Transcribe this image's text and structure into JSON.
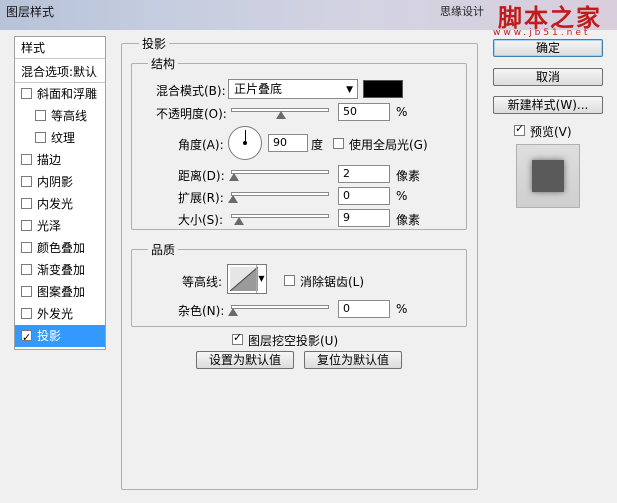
{
  "window": {
    "title": "图层样式",
    "watermark_small": "思缘设计",
    "watermark_brand": "脚本之家",
    "watermark_url": "www.jb51.net"
  },
  "left_panel": {
    "header": "样式",
    "blend_options": "混合选项:默认",
    "items": [
      {
        "label": "斜面和浮雕",
        "checked": false,
        "indent": false
      },
      {
        "label": "等高线",
        "checked": false,
        "indent": true
      },
      {
        "label": "纹理",
        "checked": false,
        "indent": true
      },
      {
        "label": "描边",
        "checked": false,
        "indent": false
      },
      {
        "label": "内阴影",
        "checked": false,
        "indent": false
      },
      {
        "label": "内发光",
        "checked": false,
        "indent": false
      },
      {
        "label": "光泽",
        "checked": false,
        "indent": false
      },
      {
        "label": "颜色叠加",
        "checked": false,
        "indent": false
      },
      {
        "label": "渐变叠加",
        "checked": false,
        "indent": false
      },
      {
        "label": "图案叠加",
        "checked": false,
        "indent": false
      },
      {
        "label": "外发光",
        "checked": false,
        "indent": false
      },
      {
        "label": "投影",
        "checked": true,
        "indent": false,
        "selected": true
      }
    ]
  },
  "drop_shadow": {
    "title": "投影",
    "structure": {
      "title": "结构",
      "blend_mode_label": "混合模式(B):",
      "blend_mode_value": "正片叠底",
      "shadow_color": "#000000",
      "opacity_label": "不透明度(O):",
      "opacity_value": "50",
      "opacity_unit": "%",
      "angle_label": "角度(A):",
      "angle_value": "90",
      "angle_unit": "度",
      "global_light_label": "使用全局光(G)",
      "global_light_checked": false,
      "distance_label": "距离(D):",
      "distance_value": "2",
      "distance_unit": "像素",
      "spread_label": "扩展(R):",
      "spread_value": "0",
      "spread_unit": "%",
      "size_label": "大小(S):",
      "size_value": "9",
      "size_unit": "像素"
    },
    "quality": {
      "title": "品质",
      "contour_label": "等高线:",
      "anti_alias_label": "消除锯齿(L)",
      "anti_alias_checked": false,
      "noise_label": "杂色(N):",
      "noise_value": "0",
      "noise_unit": "%"
    },
    "knockout_label": "图层挖空投影(U)",
    "knockout_checked": true,
    "make_default_label": "设置为默认值",
    "reset_default_label": "复位为默认值"
  },
  "right_panel": {
    "ok_label": "确定",
    "cancel_label": "取消",
    "new_style_label": "新建样式(W)...",
    "preview_label": "预览(V)",
    "preview_checked": true
  }
}
